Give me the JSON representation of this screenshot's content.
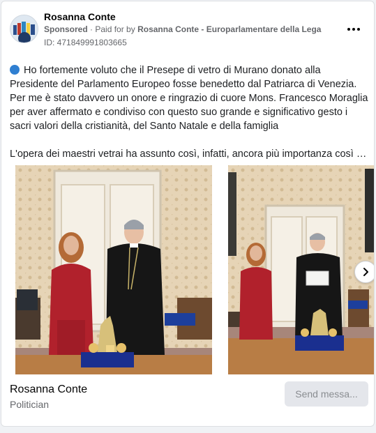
{
  "header": {
    "page_name": "Rosanna Conte",
    "sponsored_label": "Sponsored",
    "paid_for_prefix": "Paid for by",
    "paid_for_by": "Rosanna Conte - Europarlamentare della Lega",
    "ad_id": "ID: 471849991803665"
  },
  "post": {
    "paragraph_1": "Ho fortemente voluto che il Presepe di vetro di Murano donato alla Presidente del Parlamento Europeo fosse benedetto dal Patriarca di Venezia. Per me è stato davvero un onore e ringrazio di cuore Mons. Francesco Moraglia per aver affermato e condiviso con questo suo grande e significativo gesto i sacri valori della cristianità, del Santo Natale e della famiglia",
    "paragraph_2": "L'opera dei maestri vetrai ha assunto così, infatti, ancora più importanza così com..."
  },
  "icons": {
    "bullet": "blue-circle-icon",
    "more": "more-options-icon",
    "next": "chevron-right-icon"
  },
  "colors": {
    "bullet_blue": "#2f7fd1",
    "button_bg": "#e4e6eb",
    "button_text": "#8a8d91"
  },
  "footer": {
    "name": "Rosanna Conte",
    "category": "Politician",
    "cta_label": "Send messa..."
  }
}
